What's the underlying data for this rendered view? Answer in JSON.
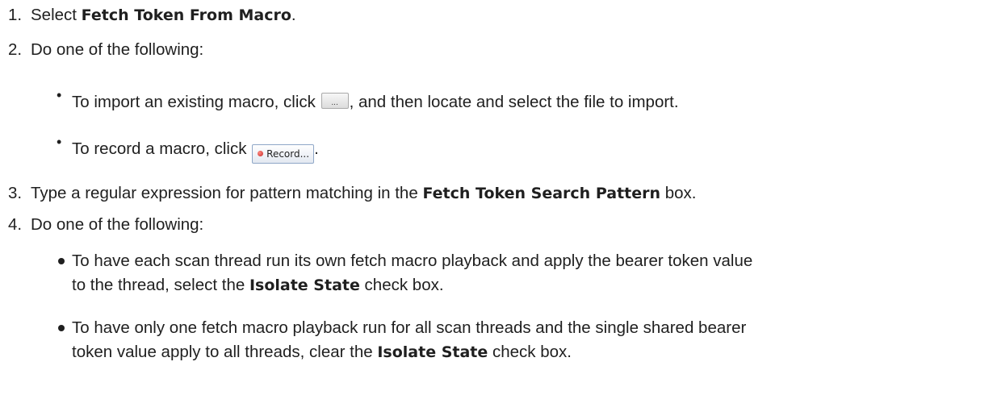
{
  "steps": [
    {
      "number": "1.",
      "pre": "Select ",
      "bold": "Fetch Token From Macro",
      "post": "."
    },
    {
      "number": "2.",
      "text": "Do one of the following:"
    },
    {
      "number": "3.",
      "pre": "Type a regular expression for pattern matching in the ",
      "bold": "Fetch Token Search Pattern",
      "post": " box."
    },
    {
      "number": "4.",
      "text": "Do one of the following:"
    }
  ],
  "step2_options": [
    {
      "pre": "To import an existing macro, click ",
      "button_icon": "ellipsis-icon",
      "button_label": "...",
      "post": ", and then locate and select the file to import."
    },
    {
      "pre": "To record a macro, click ",
      "button_icon": "record-dot-icon",
      "button_label": "Record...",
      "post": "."
    }
  ],
  "step4_options": [
    {
      "line1": "To have each scan thread run its own fetch macro playback and apply the bearer token value",
      "line2_pre": "to the thread, select the ",
      "line2_bold": "Isolate State",
      "line2_post": " check box."
    },
    {
      "line1": "To have only one fetch macro playback run for all scan threads and the single shared bearer",
      "line2_pre": "token value apply to all threads, clear the ",
      "line2_bold": "Isolate State",
      "line2_post": " check box."
    }
  ]
}
